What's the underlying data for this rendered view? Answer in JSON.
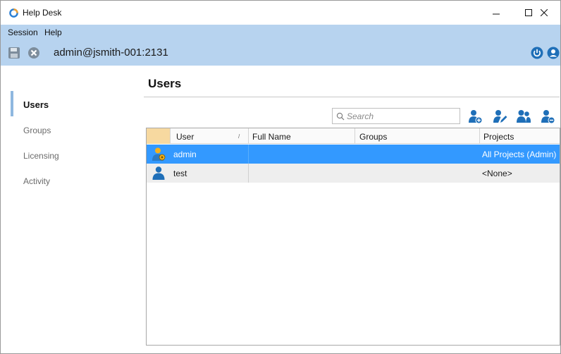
{
  "window": {
    "title": "Help Desk",
    "controls": [
      "minimize",
      "maximize",
      "close"
    ]
  },
  "menu": {
    "items": [
      "Session",
      "Help"
    ]
  },
  "connection": {
    "label": "admin@jsmith-001:2131",
    "icons": [
      "save-icon",
      "disconnect-icon",
      "power-icon",
      "account-icon"
    ]
  },
  "sidebar": {
    "items": [
      {
        "label": "Users",
        "active": true
      },
      {
        "label": "Groups",
        "active": false
      },
      {
        "label": "Licensing",
        "active": false
      },
      {
        "label": "Activity",
        "active": false
      }
    ]
  },
  "main": {
    "title": "Users",
    "search": {
      "placeholder": "Search",
      "value": ""
    },
    "toolbar": [
      "add-user-icon",
      "edit-user-icon",
      "user-groups-icon",
      "remove-user-icon"
    ]
  },
  "table": {
    "columns": [
      "User",
      "Full Name",
      "Groups",
      "Projects"
    ],
    "sort_column": "User",
    "rows": [
      {
        "user": "admin",
        "full_name": "",
        "groups": "",
        "projects": "All Projects (Admin)",
        "selected": true,
        "icon": "admin-user-icon"
      },
      {
        "user": "test",
        "full_name": "",
        "groups": "",
        "projects": "<None>",
        "selected": false,
        "icon": "user-icon"
      }
    ]
  },
  "colors": {
    "accent_bar": "#b7d3ef",
    "selection": "#3399ff",
    "icon_blue": "#1f6fb8",
    "sidebar_indicator": "#8fb8e0"
  }
}
